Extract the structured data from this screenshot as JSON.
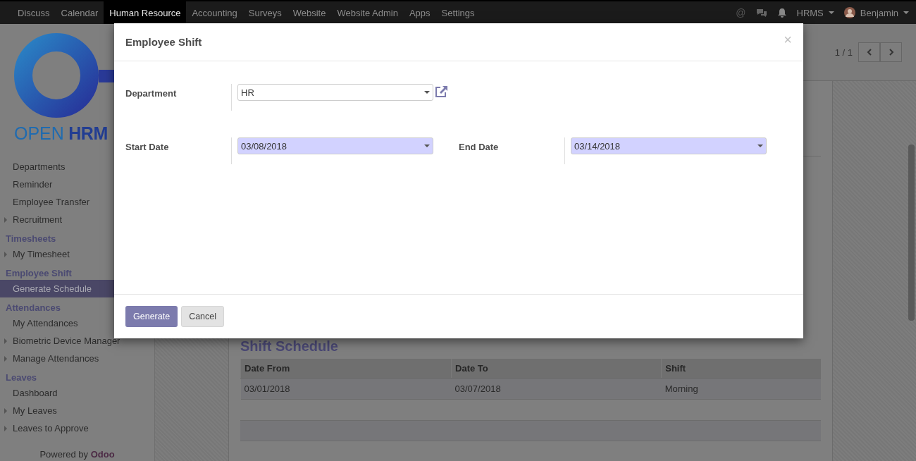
{
  "top_menu": {
    "apps": [
      {
        "label": "Discuss",
        "selected": false
      },
      {
        "label": "Calendar",
        "selected": false
      },
      {
        "label": "Human Resource",
        "selected": true
      },
      {
        "label": "Accounting",
        "selected": false
      },
      {
        "label": "Surveys",
        "selected": false
      },
      {
        "label": "Website",
        "selected": false
      },
      {
        "label": "Website Admin",
        "selected": false
      },
      {
        "label": "Apps",
        "selected": false
      },
      {
        "label": "Settings",
        "selected": false
      }
    ],
    "mention": "@",
    "company": "HRMS",
    "user": "Benjamin"
  },
  "sidebar": {
    "logo_light": "OPEN",
    "logo_bold": "HRM",
    "sections": [
      {
        "items": [
          {
            "label": "Departments",
            "expandable": false,
            "selected": false
          },
          {
            "label": "Reminder",
            "expandable": false,
            "selected": false
          },
          {
            "label": "Employee Transfer",
            "expandable": false,
            "selected": false
          },
          {
            "label": "Recruitment",
            "expandable": true,
            "selected": false
          }
        ]
      },
      {
        "title": "Timesheets",
        "items": [
          {
            "label": "My Timesheet",
            "expandable": true,
            "selected": false
          }
        ]
      },
      {
        "title": "Employee Shift",
        "items": [
          {
            "label": "Generate Schedule",
            "expandable": false,
            "selected": true
          }
        ]
      },
      {
        "title": "Attendances",
        "items": [
          {
            "label": "My Attendances",
            "expandable": false,
            "selected": false
          },
          {
            "label": "Biometric Device Manager",
            "expandable": true,
            "selected": false
          },
          {
            "label": "Manage Attendances",
            "expandable": true,
            "selected": false
          }
        ]
      },
      {
        "title": "Leaves",
        "items": [
          {
            "label": "Dashboard",
            "expandable": false,
            "selected": false
          },
          {
            "label": "My Leaves",
            "expandable": true,
            "selected": false
          },
          {
            "label": "Leaves to Approve",
            "expandable": true,
            "selected": false
          }
        ]
      }
    ],
    "footer": "Powered by **Odoo**"
  },
  "pager": "1 / 1",
  "form": {
    "section_title": "Shift Schedule",
    "columns": [
      "Date From",
      "Date To",
      "Shift"
    ],
    "rows": [
      [
        "03/01/2018",
        "03/07/2018",
        "Morning"
      ]
    ]
  },
  "dialog": {
    "title": "Employee Shift",
    "close": "×",
    "department": {
      "label": "Department",
      "value": "HR"
    },
    "start_date": {
      "label": "Start Date",
      "value": "03/08/2018"
    },
    "end_date": {
      "label": "End Date",
      "value": "03/14/2018"
    },
    "buttons": [
      {
        "label": "Generate",
        "kind": "primary"
      },
      {
        "label": "Cancel",
        "kind": "secondary"
      }
    ]
  }
}
